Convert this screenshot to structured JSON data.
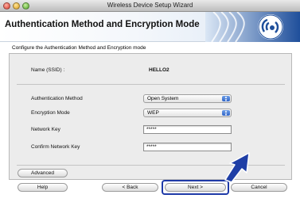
{
  "window": {
    "title": "Wireless Device Setup Wizard"
  },
  "header": {
    "title": "Authentication Method and Encryption Mode"
  },
  "subtitle": "Configure the Authentication Method and Encryption mode",
  "ssid": {
    "label": "Name (SSID) :",
    "value": "HELLO2"
  },
  "form": {
    "auth_label": "Authentication Method",
    "auth_value": "Open System",
    "enc_label": "Encryption Mode",
    "enc_value": "WEP",
    "key_label": "Network Key",
    "key_value": "*****",
    "confirm_label": "Confirm Network Key",
    "confirm_value": "*****"
  },
  "buttons": {
    "advanced": "Advanced",
    "help": "Help",
    "back": "< Back",
    "next": "Next >",
    "cancel": "Cancel"
  },
  "colors": {
    "arrow": "#1f3fa6",
    "focus": "#1f3aa8"
  },
  "icons": {
    "logo": "wireless-logo-icon",
    "pointer": "pointer-arrow-icon"
  }
}
